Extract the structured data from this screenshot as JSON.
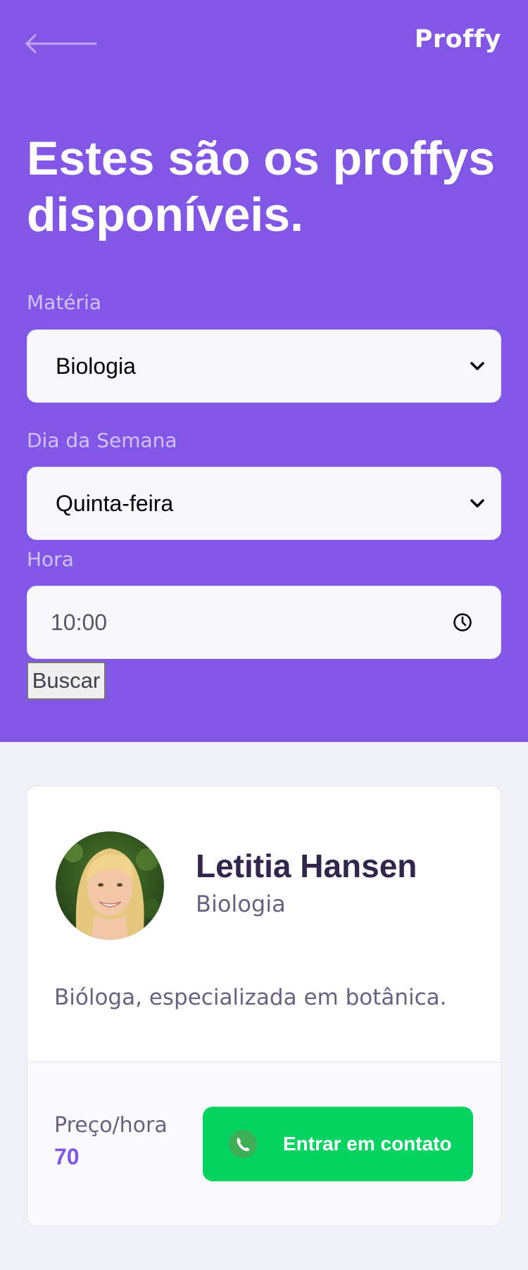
{
  "header": {
    "logo": "Proffy",
    "back_icon": "arrow-left-icon"
  },
  "page": {
    "title_line1": "Estes são os proffys",
    "title_line2": "disponíveis."
  },
  "filters": {
    "subject": {
      "label": "Matéria",
      "value": "Biologia"
    },
    "weekday": {
      "label": "Dia da Semana",
      "value": "Quinta-feira"
    },
    "time": {
      "label": "Hora",
      "value": "10:00"
    },
    "search_label": "Buscar"
  },
  "teacher": {
    "name": "Letitia Hansen",
    "subject": "Biologia",
    "bio": "Bióloga, especializada em botânica.",
    "price_label": "Preço/hora",
    "price": "70",
    "contact_label": "Entrar em contato",
    "contact_icon": "whatsapp-icon"
  },
  "colors": {
    "primary": "#8257E5",
    "background": "#F0F0F7",
    "contact_green": "#04D361",
    "title_text": "#32264D",
    "body_text": "#6A6180"
  }
}
